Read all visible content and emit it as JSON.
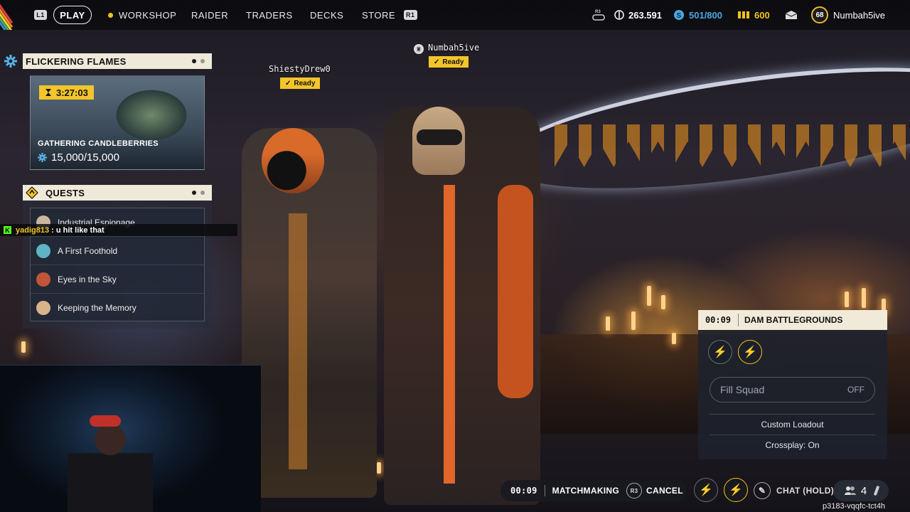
{
  "nav": {
    "left_key": "L1",
    "right_key": "R1",
    "play": "PLAY",
    "items": [
      "WORKSHOP",
      "RAIDER",
      "TRADERS",
      "DECKS",
      "STORE"
    ]
  },
  "stats": {
    "r3_key": "R3",
    "coins": "263.591",
    "seeds": "501/800",
    "credits": "600",
    "level": "68",
    "username": "Numbah5ive"
  },
  "event": {
    "title": "FLICKERING FLAMES",
    "timer": "3:27:03",
    "name": "GATHERING CANDLEBERRIES",
    "progress": "15,000/15,000"
  },
  "quests": {
    "title": "QUESTS",
    "items": [
      {
        "label": "Industrial Espionage",
        "color": "#c9b7a0"
      },
      {
        "label": "A First Foothold",
        "color": "#5fb3c4"
      },
      {
        "label": "Eyes in the Sky",
        "color": "#c0553a"
      },
      {
        "label": "Keeping the Memory",
        "color": "#d8b48a"
      }
    ]
  },
  "chat_overlay": {
    "user": "yadig813",
    "message": " : u hit like that"
  },
  "players": {
    "p1": {
      "name": "ShiestyDrew0",
      "status": "Ready"
    },
    "p2": {
      "name": "Numbah5ive",
      "status": "Ready"
    }
  },
  "squad": {
    "timer": "00:09",
    "map": "DAM BATTLEGROUNDS",
    "fill_label": "Fill Squad",
    "fill_value": "OFF",
    "custom_loadout": "Custom Loadout",
    "crossplay": "Crossplay: On"
  },
  "bottom": {
    "timer": "00:09",
    "matchmaking": "MATCHMAKING",
    "r3_key": "R3",
    "cancel": "CANCEL",
    "chat": "CHAT (HOLD)",
    "player_count": "4",
    "session_id": "p3183-vqqfc-tct4h"
  },
  "colors": {
    "accent": "#f4c52a",
    "panel_header": "#efe9d9",
    "seeds": "#4aa8e0"
  }
}
